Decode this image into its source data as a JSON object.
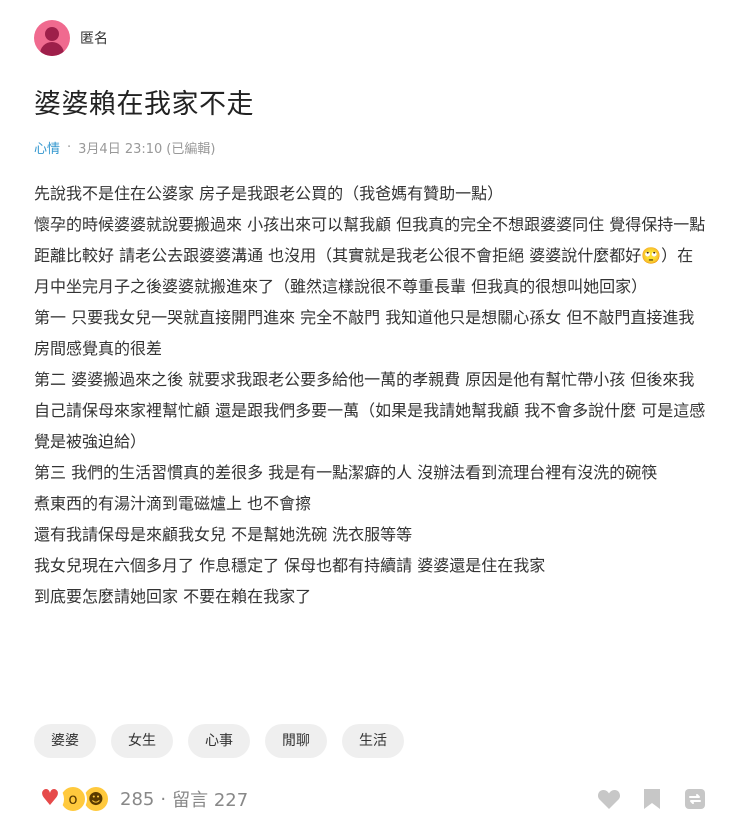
{
  "author": {
    "name": "匿名",
    "avatar_icon": "female-avatar-icon",
    "avatar_color": "#f06a8f"
  },
  "post": {
    "title": "婆婆賴在我家不走",
    "forum": "心情",
    "date": "3月4日 23:10",
    "edited": "(已編輯)",
    "paragraphs": [
      "先說我不是住在公婆家 房子是我跟老公買的（我爸媽有贊助一點）",
      "懷孕的時候婆婆就說要搬過來 小孩出來可以幫我顧 但我真的完全不想跟婆婆同住 覺得保持一點距離比較好 請老公去跟婆婆溝通 也沒用（其實就是我老公很不會拒絕 婆婆說什麼都好🙄）在月中坐完月子之後婆婆就搬進來了（雖然這樣說很不尊重長輩 但我真的很想叫她回家）",
      "第一 只要我女兒一哭就直接開門進來 完全不敲門 我知道他只是想關心孫女 但不敲門直接進我房間感覺真的很差",
      "第二 婆婆搬過來之後 就要求我跟老公要多給他一萬的孝親費 原因是他有幫忙帶小孩 但後來我自己請保母來家裡幫忙顧 還是跟我們多要一萬（如果是我請她幫我顧 我不會多說什麼 可是這感覺是被強迫給）",
      "第三 我們的生活習慣真的差很多 我是有一點潔癖的人 沒辦法看到流理台裡有沒洗的碗筷",
      "煮東西的有湯汁滴到電磁爐上 也不會擦",
      "還有我請保母是來顧我女兒 不是幫她洗碗 洗衣服等等",
      "我女兒現在六個多月了 作息穩定了 保母也都有持續請 婆婆還是住在我家",
      "到底要怎麼請她回家 不要在賴在我家了"
    ]
  },
  "tags": [
    "婆婆",
    "女生",
    "心事",
    "閒聊",
    "生活"
  ],
  "footer": {
    "reaction_count": "285",
    "separator": "·",
    "comments": "留言 227",
    "reaction_icons": [
      "heart-icon",
      "wow-face-icon",
      "laugh-face-icon"
    ],
    "action_icons": [
      "like-heart-icon",
      "bookmark-icon",
      "share-icon"
    ],
    "icon_color": "#c7c7c7"
  }
}
